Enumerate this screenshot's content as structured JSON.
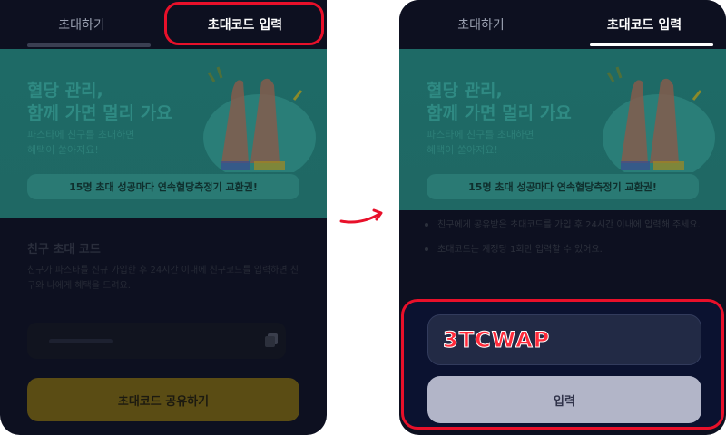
{
  "tabs": {
    "invite": "초대하기",
    "enter_code": "초대코드 입력"
  },
  "banner": {
    "title_line1": "혈당 관리,",
    "title_line2": "함께 가면 멀리 가요",
    "sub_line1": "파스타에 친구를 초대하면",
    "sub_line2": "혜택이 쏟아져요!",
    "reward_pill": "15명 초대 성공마다 연속혈당측정기 교환권!"
  },
  "left": {
    "section_title": "친구 초대 코드",
    "section_desc": "친구가 파스타를 신규 가입한 후 24시간 이내에 친구코드를 입력하면 친구와 나에게 혜택을 드려요.",
    "share_button": "초대코드 공유하기"
  },
  "right": {
    "notes": [
      "친구에게 공유받은 초대코드를 가입 후 24시간 이내에 입력해 주세요.",
      "초대코드는 계정당 1회만 입력할 수 있어요."
    ],
    "code_value": "3TCWAP",
    "submit_button": "입력"
  },
  "colors": {
    "highlight": "#e8102a",
    "banner": "#1e6a66",
    "share_button": "#5a4c14",
    "background": "#0d1020"
  },
  "icons": [
    "copy-icon",
    "arrow-right-icon",
    "high-five-illustration"
  ]
}
